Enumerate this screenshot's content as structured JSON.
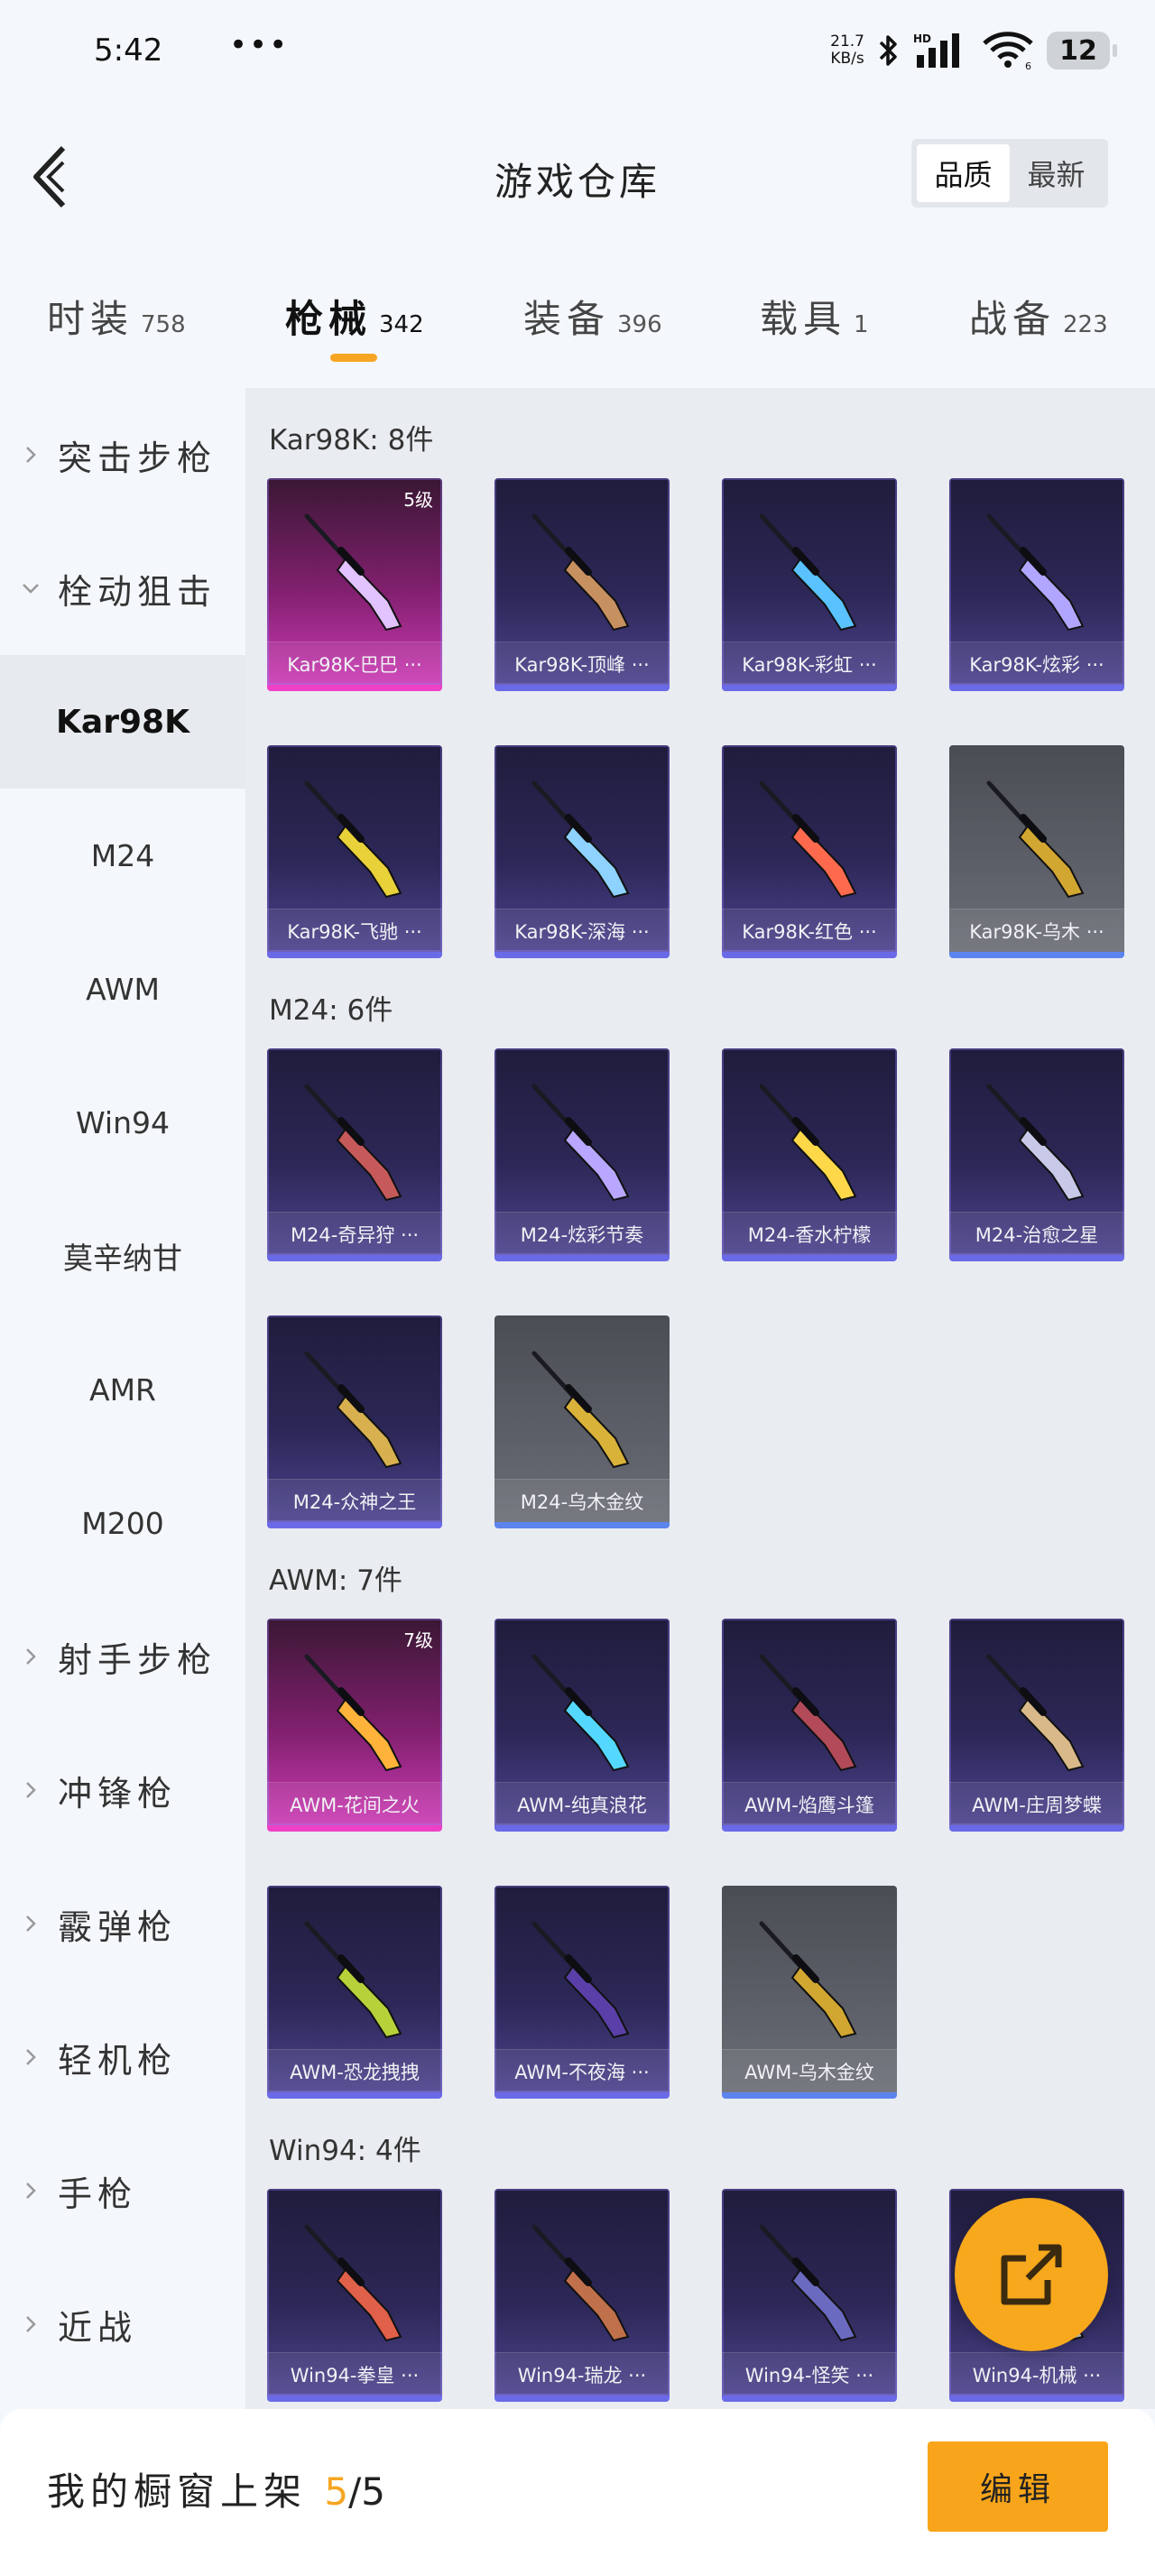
{
  "status": {
    "time": "5:42",
    "more": "•••",
    "speed_top": "21.7",
    "speed_bottom": "KB/s",
    "battery": "12",
    "wifi_badge": "6"
  },
  "header": {
    "title": "游戏仓库",
    "sort_quality": "品质",
    "sort_newest": "最新"
  },
  "tabs": [
    {
      "label": "时装",
      "count": "758"
    },
    {
      "label": "枪械",
      "count": "342"
    },
    {
      "label": "装备",
      "count": "396"
    },
    {
      "label": "载具",
      "count": "1"
    },
    {
      "label": "战备",
      "count": "223"
    }
  ],
  "sidebar": {
    "categories": [
      "突击步枪",
      "栓动狙击",
      "射手步枪",
      "冲锋枪",
      "霰弹枪",
      "轻机枪",
      "手枪",
      "近战"
    ],
    "subitems": [
      "Kar98K",
      "M24",
      "AWM",
      "Win94",
      "莫辛纳甘",
      "AMR",
      "M200"
    ]
  },
  "sections": [
    {
      "title": "Kar98K: 8件",
      "items": [
        {
          "name": "Kar98K-巴巴 ···",
          "tier": "pink",
          "level": "5级"
        },
        {
          "name": "Kar98K-顶峰 ···",
          "tier": "purple"
        },
        {
          "name": "Kar98K-彩虹 ···",
          "tier": "purple"
        },
        {
          "name": "Kar98K-炫彩 ···",
          "tier": "purple"
        },
        {
          "name": "Kar98K-飞驰 ···",
          "tier": "purple"
        },
        {
          "name": "Kar98K-深海 ···",
          "tier": "purple"
        },
        {
          "name": "Kar98K-红色 ···",
          "tier": "purple"
        },
        {
          "name": "Kar98K-乌木 ···",
          "tier": "gray"
        }
      ]
    },
    {
      "title": "M24: 6件",
      "items": [
        {
          "name": "M24-奇异狩 ···",
          "tier": "purple"
        },
        {
          "name": "M24-炫彩节奏",
          "tier": "purple"
        },
        {
          "name": "M24-香水柠檬",
          "tier": "purple"
        },
        {
          "name": "M24-治愈之星",
          "tier": "purple"
        },
        {
          "name": "M24-众神之王",
          "tier": "purple"
        },
        {
          "name": "M24-乌木金纹",
          "tier": "gray"
        }
      ]
    },
    {
      "title": "AWM: 7件",
      "items": [
        {
          "name": "AWM-花间之火",
          "tier": "pink",
          "level": "7级"
        },
        {
          "name": "AWM-纯真浪花",
          "tier": "purple"
        },
        {
          "name": "AWM-焰鹰斗篷",
          "tier": "purple"
        },
        {
          "name": "AWM-庄周梦蝶",
          "tier": "purple"
        },
        {
          "name": "AWM-恐龙拽拽",
          "tier": "purple"
        },
        {
          "name": "AWM-不夜海 ···",
          "tier": "purple"
        },
        {
          "name": "AWM-乌木金纹",
          "tier": "gray"
        }
      ]
    },
    {
      "title": "Win94: 4件",
      "items": [
        {
          "name": "Win94-拳皇 ···",
          "tier": "purple"
        },
        {
          "name": "Win94-瑞龙 ···",
          "tier": "purple"
        },
        {
          "name": "Win94-怪笑 ···",
          "tier": "purple"
        },
        {
          "name": "Win94-机械 ···",
          "tier": "purple"
        }
      ]
    }
  ],
  "bottom": {
    "label": "我的橱窗上架",
    "current": "5",
    "total": "/5",
    "edit": "编辑"
  },
  "colors": {
    "accent": "#f6a623",
    "pink_tier": "#ee41c6",
    "purple_tier": "#6a6ae8",
    "gray_tier": "#5c84ee"
  }
}
